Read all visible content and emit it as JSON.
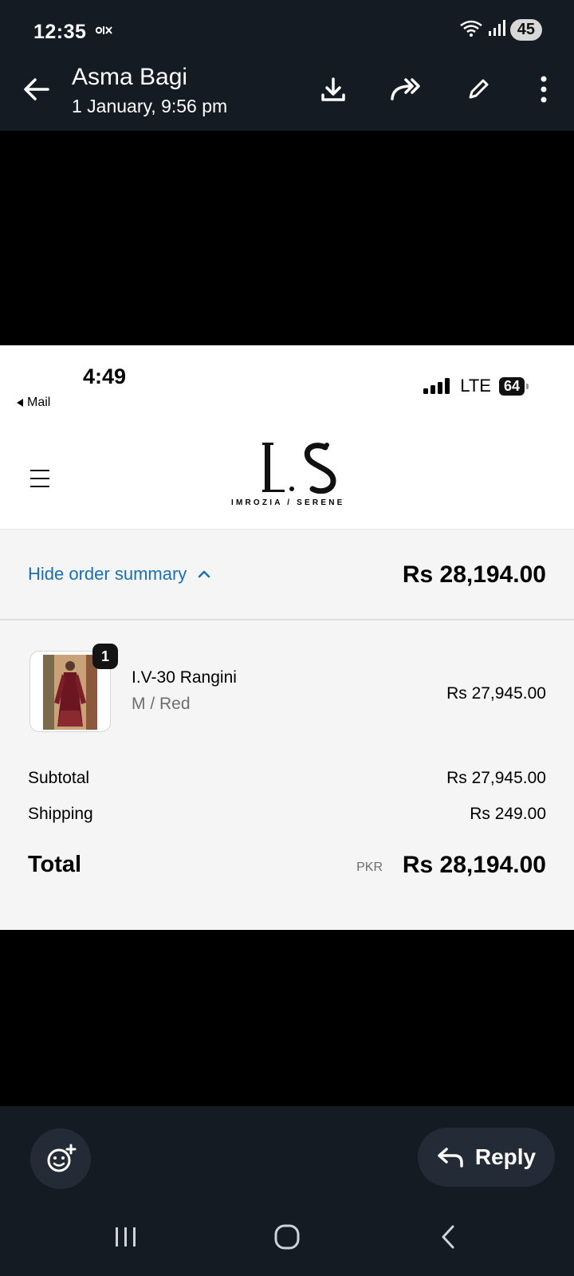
{
  "status_bar": {
    "time": "12:35",
    "app_icon": "olx-icon",
    "battery": "45"
  },
  "top_bar": {
    "sender": "Asma Bagi",
    "date": "1 January, 9:56 pm"
  },
  "screenshot": {
    "ios_status": {
      "time": "4:49",
      "back_label": "Mail",
      "network": "LTE",
      "battery": "64"
    },
    "store": {
      "logo_text": "IMROZIA / SERENE"
    },
    "summary": {
      "toggle_label": "Hide order summary",
      "total": "Rs 28,194.00"
    },
    "item": {
      "quantity": "1",
      "name": "I.V-30 Rangini",
      "variant": "M / Red",
      "price": "Rs 27,945.00"
    },
    "subtotal": {
      "label": "Subtotal",
      "value": "Rs 27,945.00"
    },
    "shipping": {
      "label": "Shipping",
      "value": "Rs 249.00"
    },
    "total": {
      "label": "Total",
      "currency": "PKR",
      "value": "Rs 28,194.00"
    }
  },
  "bottom_bar": {
    "reply_label": "Reply"
  },
  "colors": {
    "chrome_bg": "#141b22",
    "link_blue": "#1a6fb3",
    "summary_bg": "#f5f5f5"
  }
}
